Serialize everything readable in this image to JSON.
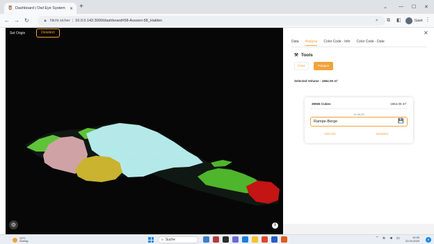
{
  "browser": {
    "tab_title": "Dashboard | Owl Eye System",
    "new_tab": "+",
    "url_not_secure": "Nicht sicher",
    "url": "10.0.0.142:3000/dashboard#58-Aussen-58_Halden",
    "profile_name": "Gast"
  },
  "viewer": {
    "set_origin": "Set Origin",
    "deselect": "Deselect",
    "regions": [
      {
        "name": "green-left",
        "color": "#5fc33a"
      },
      {
        "name": "pink",
        "color": "#cfa3a6"
      },
      {
        "name": "cyan",
        "color": "#b6ebeb"
      },
      {
        "name": "yellow",
        "color": "#c9b32f"
      },
      {
        "name": "green-right",
        "color": "#4fb52c"
      },
      {
        "name": "red",
        "color": "#c41414"
      }
    ]
  },
  "panel": {
    "tabs": [
      {
        "label": "Data",
        "active": false
      },
      {
        "label": "Analyse",
        "active": true
      },
      {
        "label": "Color Code - Info",
        "active": false
      },
      {
        "label": "Color Code - Date",
        "active": false
      }
    ],
    "tools_title": "Tools",
    "draw_label": "Draw",
    "polygon_label": "Polygon",
    "selected_volume": "Selected Volume : 1864.05 m³",
    "card": {
      "cube_count": "39065 Cubes",
      "volume": "1864.05 m³",
      "date": "11.04.23",
      "name_value": "Rampe-Berge",
      "add_info": "Add Info",
      "deselect": "Deselect"
    }
  },
  "taskbar": {
    "temperature": "13°C",
    "weather": "Sonnig",
    "search": "Suche",
    "time": "10:09",
    "date": "22.04.2023",
    "notifications": "6"
  },
  "colors": {
    "accent": "#f0a33a",
    "viewer_bg": "#070707"
  }
}
